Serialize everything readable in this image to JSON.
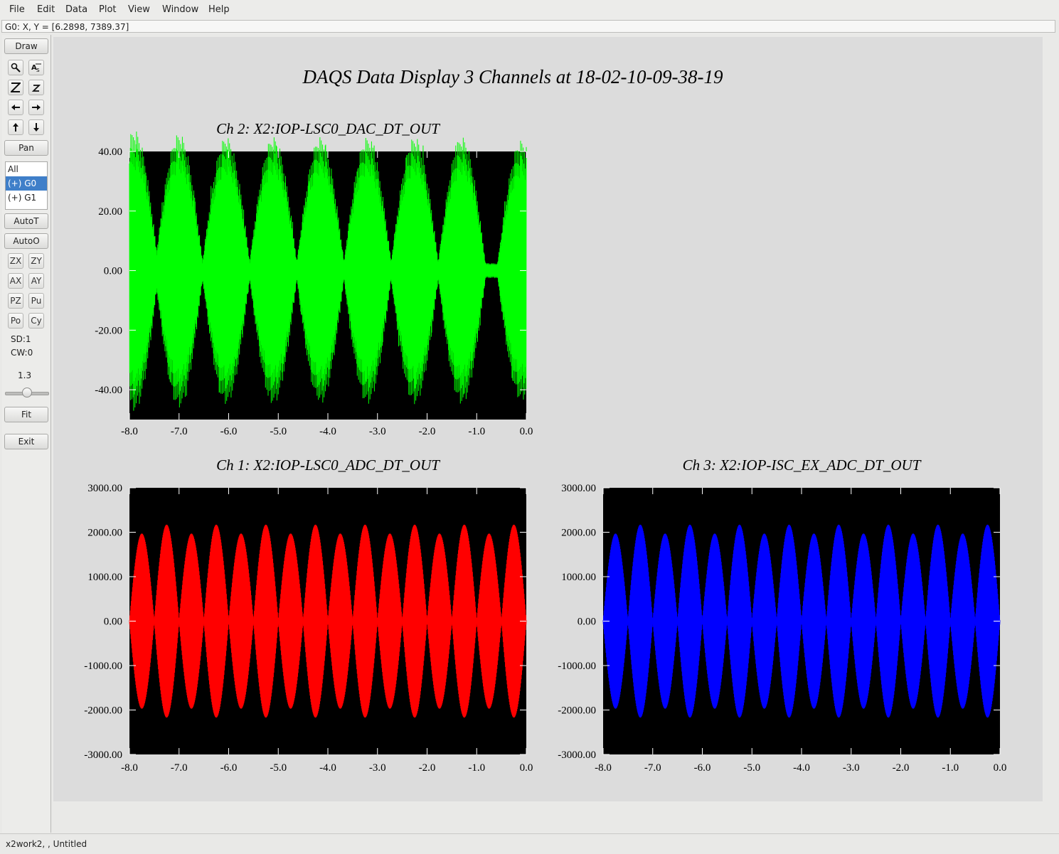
{
  "menu": [
    {
      "label": "File"
    },
    {
      "label": "Edit"
    },
    {
      "label": "Data"
    },
    {
      "label": "Plot"
    },
    {
      "label": "View"
    },
    {
      "label": "Window"
    },
    {
      "label": "Help"
    }
  ],
  "coord_readout": "G0: X, Y = [6.2898, 7389.37]",
  "toolbar": {
    "draw": "Draw",
    "pan": "Pan",
    "channel_list": [
      "All",
      "(+) G0",
      "(+) G1"
    ],
    "selected_channel": "(+) G0",
    "autot": "AutoT",
    "autoo": "AutoO",
    "small_buttons": [
      "ZX",
      "ZY",
      "AX",
      "AY",
      "PZ",
      "Pu",
      "Po",
      "Cy"
    ],
    "sd": "SD:1",
    "cw": "CW:0",
    "scale_value": "1.3",
    "fit": "Fit",
    "exit": "Exit"
  },
  "main_title": "DAQS Data Display 3 Channels at 18-02-10-09-38-19",
  "status": "x2work2, , Untitled",
  "chart_data": [
    {
      "type": "line",
      "title": "Ch 2:  X2:IOP-LSC0_DAC_DT_OUT",
      "color": "#00ff00",
      "background": "#000000",
      "xlim": [
        -8.0,
        0.0
      ],
      "ylim": [
        -50,
        40
      ],
      "xticks": [
        "-8.0",
        "-7.0",
        "-6.0",
        "-5.0",
        "-4.0",
        "-3.0",
        "-2.0",
        "-1.0",
        "0.0"
      ],
      "yticks": [
        "40.00",
        "20.00",
        "0.00",
        "-20.00",
        "-40.00"
      ],
      "ytick_values": [
        40,
        20,
        0,
        -20,
        -40
      ],
      "envelope_peaks": {
        "x": [
          -7.9,
          -7.0,
          -6.05,
          -5.1,
          -4.15,
          -3.2,
          -2.25,
          -1.3,
          -0.1
        ],
        "amplitude": [
          39,
          38,
          37,
          37,
          37,
          37,
          37,
          37,
          36
        ]
      },
      "envelope_nodes": [
        -7.45,
        -6.5,
        -5.55,
        -4.6,
        -3.65,
        -2.7,
        -1.75,
        -0.8
      ],
      "peak_abs_max": 42
    },
    {
      "type": "line",
      "title": "Ch 1:  X2:IOP-LSC0_ADC_DT_OUT",
      "color": "#ff0000",
      "background": "#000000",
      "xlim": [
        -8.0,
        0.0
      ],
      "ylim": [
        -3000,
        3000
      ],
      "xticks": [
        "-8.0",
        "-7.0",
        "-6.0",
        "-5.0",
        "-4.0",
        "-3.0",
        "-2.0",
        "-1.0",
        "0.0"
      ],
      "yticks": [
        "3000.00",
        "2000.00",
        "1000.00",
        "0.00",
        "-1000.00",
        "-2000.00",
        "-3000.00"
      ],
      "ytick_values": [
        3000,
        2000,
        1000,
        0,
        -1000,
        -2000,
        -3000
      ],
      "lobe_centers": [
        -7.75,
        -7.25,
        -6.75,
        -6.25,
        -5.75,
        -5.25,
        -4.75,
        -4.25,
        -3.75,
        -3.25,
        -2.75,
        -2.25,
        -1.75,
        -1.25,
        -0.75,
        -0.25
      ],
      "lobe_peaks": [
        1950,
        2150,
        1950,
        2150,
        1950,
        2150,
        1950,
        2150,
        1950,
        2150,
        1950,
        2150,
        1950,
        2150,
        1950,
        2150
      ]
    },
    {
      "type": "line",
      "title": "Ch 3:  X2:IOP-ISC_EX_ADC_DT_OUT",
      "color": "#0000ff",
      "background": "#000000",
      "xlim": [
        -8.0,
        0.0
      ],
      "ylim": [
        -3000,
        3000
      ],
      "xticks": [
        "-8.0",
        "-7.0",
        "-6.0",
        "-5.0",
        "-4.0",
        "-3.0",
        "-2.0",
        "-1.0",
        "0.0"
      ],
      "yticks": [
        "3000.00",
        "2000.00",
        "1000.00",
        "0.00",
        "-1000.00",
        "-2000.00",
        "-3000.00"
      ],
      "ytick_values": [
        3000,
        2000,
        1000,
        0,
        -1000,
        -2000,
        -3000
      ],
      "lobe_centers": [
        -7.75,
        -7.25,
        -6.75,
        -6.25,
        -5.75,
        -5.25,
        -4.75,
        -4.25,
        -3.75,
        -3.25,
        -2.75,
        -2.25,
        -1.75,
        -1.25,
        -0.75,
        -0.25
      ],
      "lobe_peaks": [
        1950,
        2150,
        1950,
        2150,
        1950,
        2150,
        1950,
        2150,
        1950,
        2150,
        1950,
        2150,
        1950,
        2150,
        1950,
        2150
      ]
    }
  ]
}
